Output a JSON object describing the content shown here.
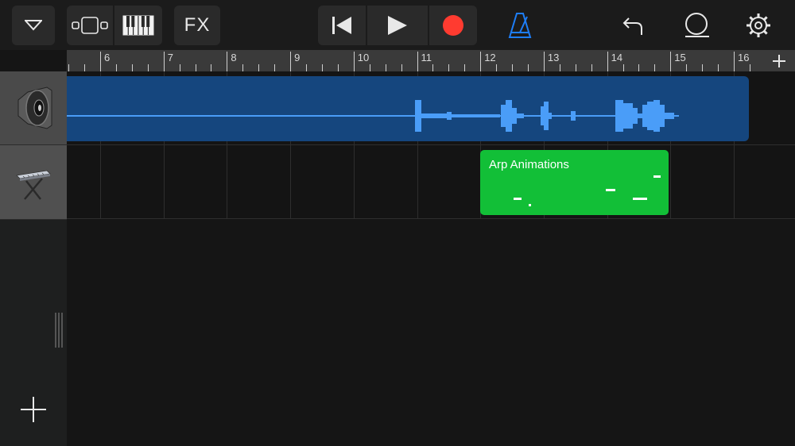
{
  "toolbar": {
    "browser_menu": {
      "icon": "chevron-down-icon"
    },
    "tracks_view": {
      "icon": "tracks-view-icon"
    },
    "instrument_view": {
      "icon": "keyboard-icon"
    },
    "fx_label": "FX",
    "transport": {
      "rewind": {
        "icon": "rewind-icon"
      },
      "play": {
        "icon": "play-icon"
      },
      "record": {
        "icon": "record-icon",
        "color": "#ff3b30"
      }
    },
    "metronome": {
      "icon": "metronome-icon",
      "color": "#1e7ef7"
    },
    "undo": {
      "icon": "undo-icon"
    },
    "loop_browser": {
      "icon": "loop-icon"
    },
    "settings": {
      "icon": "gear-icon"
    }
  },
  "ruler": {
    "bars": [
      "6",
      "7",
      "8",
      "9",
      "10",
      "11",
      "12",
      "13",
      "14",
      "15",
      "16"
    ],
    "add_section_icon": "plus-icon"
  },
  "tracks": [
    {
      "name": "audio-recorder",
      "icon": "speaker-icon",
      "region": {
        "type": "audio",
        "color": "#15467e",
        "wave_color": "#4a9df8"
      }
    },
    {
      "name": "keyboard",
      "icon": "keyboard-instrument-icon",
      "region": {
        "type": "midi",
        "title": "Arp Animations",
        "color": "#12bf37"
      }
    }
  ],
  "sidebar": {
    "add_track_icon": "plus-icon"
  }
}
